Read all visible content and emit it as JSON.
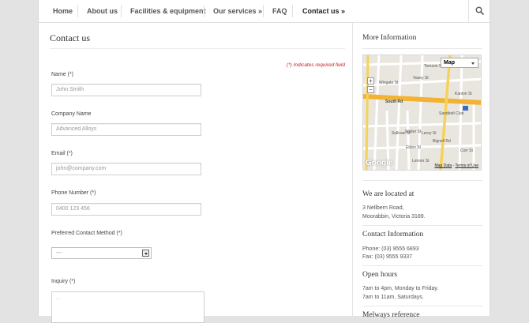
{
  "nav": {
    "items": [
      {
        "label": "Home"
      },
      {
        "label": "About us"
      },
      {
        "label": "Facilities & equipment"
      },
      {
        "label": "Our services »"
      },
      {
        "label": "FAQ"
      },
      {
        "label": "Contact us »",
        "active": true
      }
    ],
    "search_icon": "search-icon"
  },
  "main": {
    "title": "Contact us",
    "required_note": "(*) Indicates required field",
    "fields": {
      "name": {
        "label": "Name (*)",
        "placeholder": "John Smith"
      },
      "company": {
        "label": "Company Name",
        "placeholder": "Advanced Alloys"
      },
      "email": {
        "label": "Email (*)",
        "placeholder": "john@company.com"
      },
      "phone": {
        "label": "Phone Number (*)",
        "placeholder": "0400 123 456"
      },
      "contact_method": {
        "label": "Preferred Contact Method (*)",
        "value": "---"
      },
      "inquiry": {
        "label": "Inquiry (*)",
        "placeholder": "..."
      }
    }
  },
  "sidebar": {
    "title": "More Information",
    "map": {
      "type_label": "Map",
      "zoom_in": "+",
      "zoom_out": "−",
      "logo": "Google",
      "legal_1": "Map Data",
      "legal_sep": " - ",
      "legal_2": "Terms of Use",
      "streets": [
        "Vasey St",
        "Tomson St",
        "Wingate St",
        "Kanion St",
        "South Rd",
        "Sandbelt Club",
        "Bignell Rd",
        "Sullivan St",
        "Walter St",
        "Leroy St",
        "Elden St",
        "Corr St",
        "Lemon St"
      ]
    },
    "location": {
      "heading": "We are located at",
      "line1": "3 Nellbern Road,",
      "line2": "Moorabbin, Victoria 3189."
    },
    "contact": {
      "heading": "Contact Information",
      "phone": "Phone: (03) 9555 6893",
      "fax": "Fax: (03) 9555 9337"
    },
    "hours": {
      "heading": "Open hours",
      "line1": "7am to 4pm, Monday to Friday.",
      "line2": "7am to 11am, Saturdays."
    },
    "melways": {
      "heading": "Melways reference"
    }
  }
}
